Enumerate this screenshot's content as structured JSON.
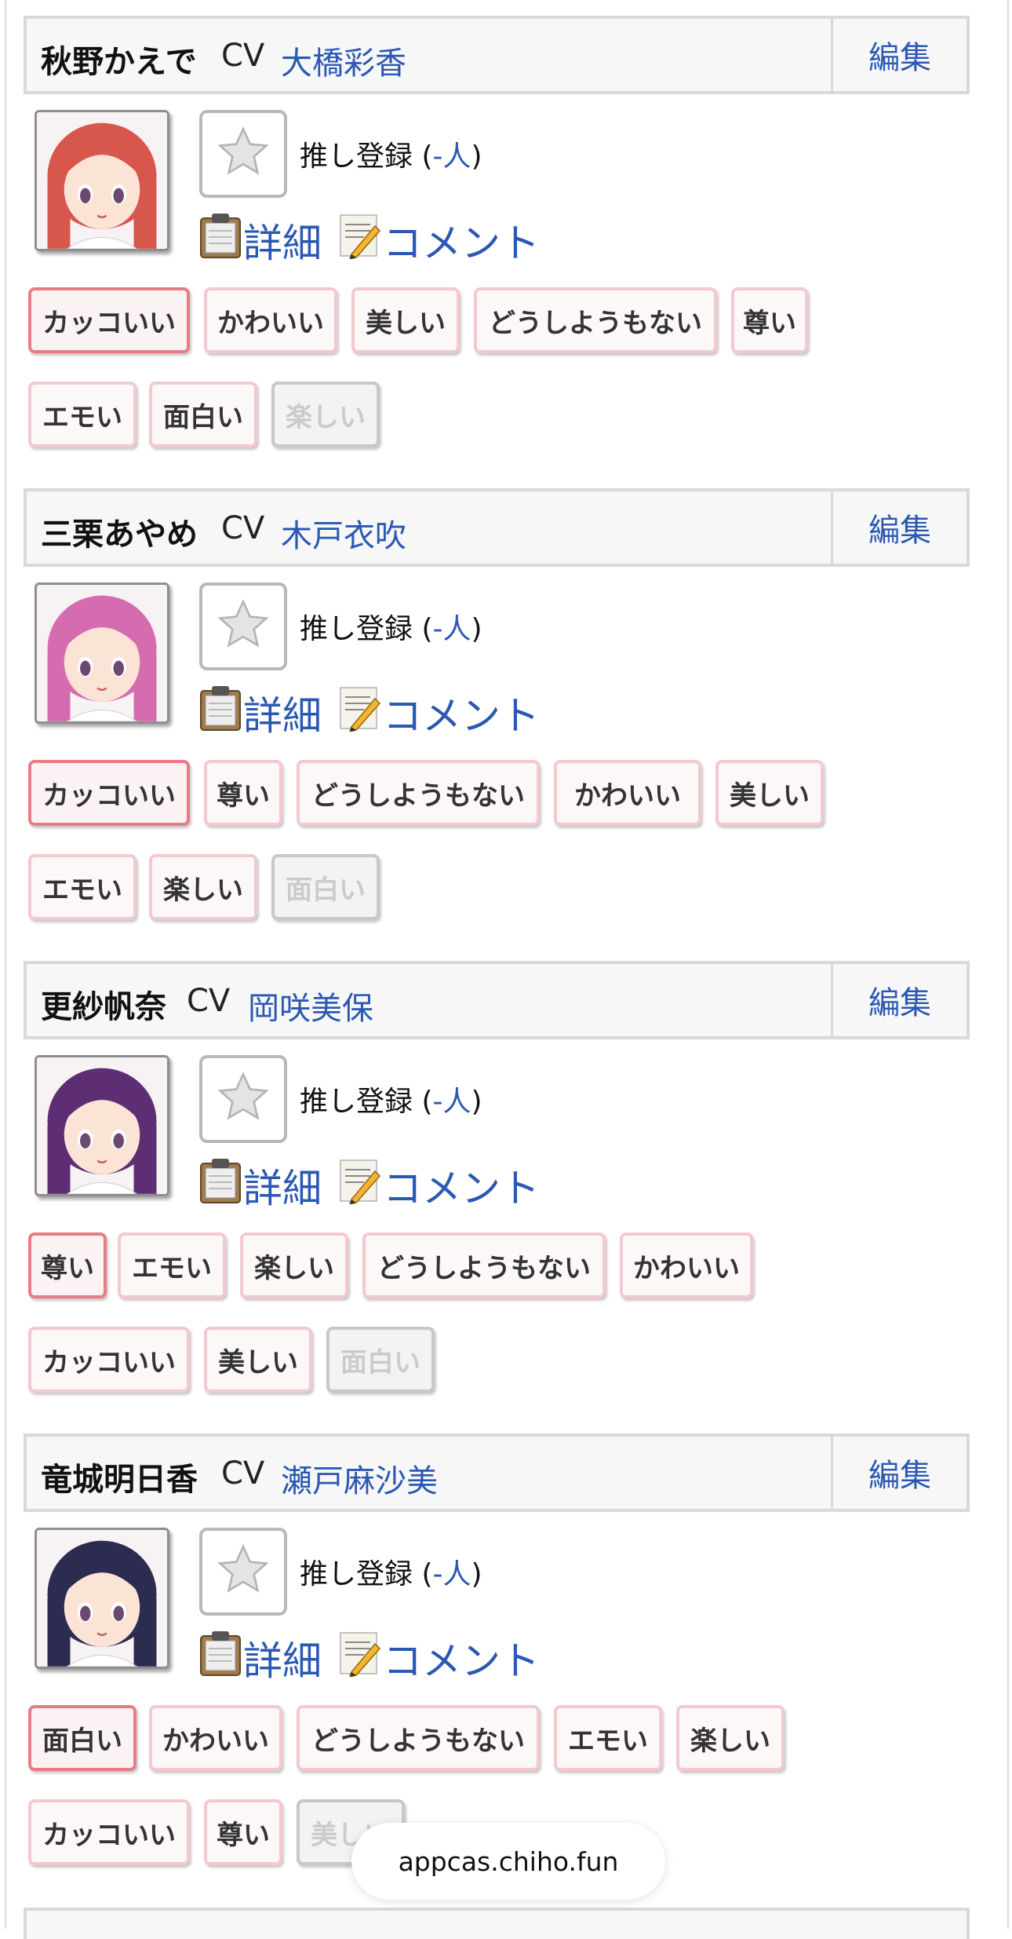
{
  "common": {
    "edit_label": "編集",
    "cv_label": "CV",
    "oshi_label": "推し登録 (",
    "oshi_count": "-人",
    "oshi_close": ")",
    "detail_label": "詳細",
    "comment_label": "コメント"
  },
  "cards": [
    {
      "name": "秋野かえで",
      "va": "大橋彩香",
      "avatar_hair": "#d8574d",
      "tags_row1": [
        "カッコいい",
        "かわいい",
        "美しい",
        "どうしようもない",
        "尊い"
      ],
      "tags_row2": [
        "エモい",
        "面白い",
        "楽しい"
      ]
    },
    {
      "name": "三栗あやめ",
      "va": "木戸衣吹",
      "avatar_hair": "#d66cb0",
      "tags_row1": [
        "カッコいい",
        "尊い",
        "どうしようもない",
        "かわいい",
        "美しい"
      ],
      "tags_row2": [
        "エモい",
        "楽しい",
        "面白い"
      ]
    },
    {
      "name": "更紗帆奈",
      "va": "岡咲美保",
      "avatar_hair": "#5e2e74",
      "tags_row1": [
        "尊い",
        "エモい",
        "楽しい",
        "どうしようもない",
        "かわいい"
      ],
      "tags_row2": [
        "カッコいい",
        "美しい",
        "面白い"
      ]
    },
    {
      "name": "竜城明日香",
      "va": "瀬戸麻沙美",
      "avatar_hair": "#2c2b50",
      "tags_row1": [
        "面白い",
        "かわいい",
        "どうしようもない",
        "エモい",
        "楽しい"
      ],
      "tags_row2": [
        "カッコいい",
        "尊い",
        "美しい"
      ]
    }
  ],
  "toast_text": "appcas.chiho.fun"
}
